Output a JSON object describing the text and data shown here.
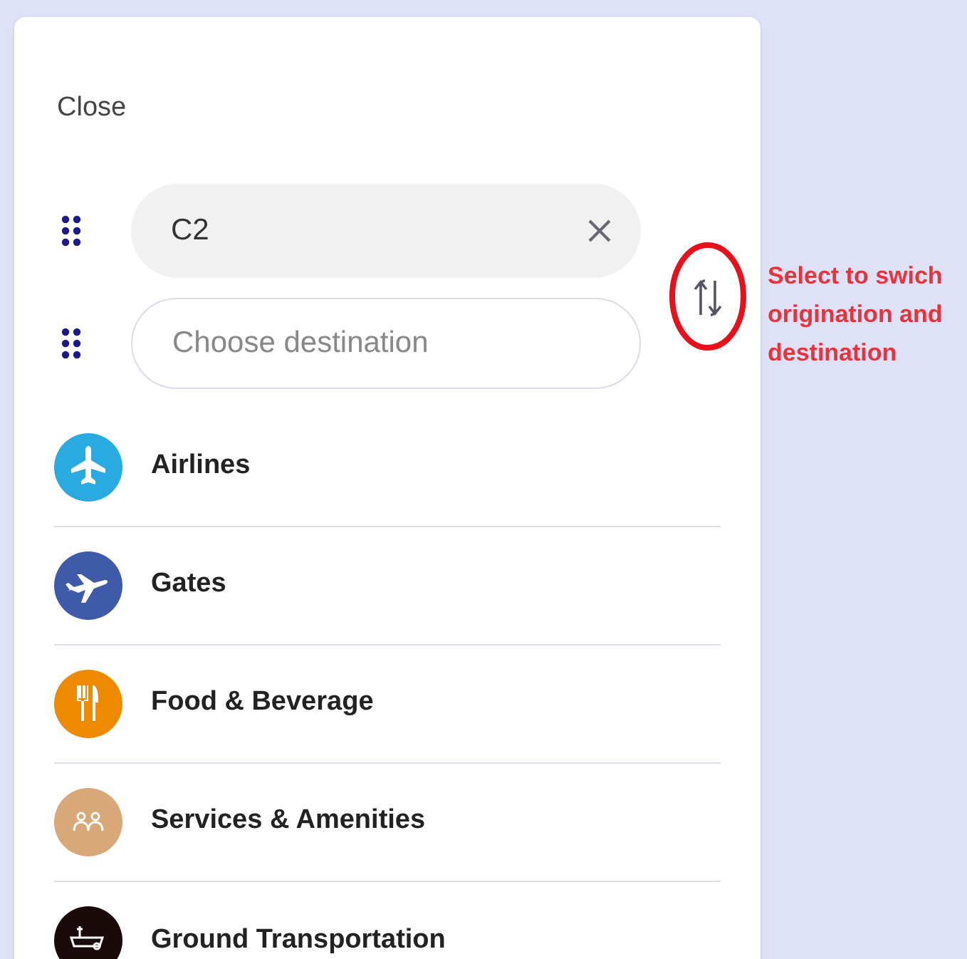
{
  "close_label": "Close",
  "origin": {
    "value": "C2"
  },
  "destination": {
    "placeholder": "Choose destination"
  },
  "annotation": "Select to swich origination and destination",
  "categories": [
    {
      "kind": "airlines",
      "label": "Airlines",
      "color": "#29abe2"
    },
    {
      "kind": "gates",
      "label": "Gates",
      "color": "#3f5aa9"
    },
    {
      "kind": "food",
      "label": "Food & Beverage",
      "color": "#ee8a00"
    },
    {
      "kind": "services",
      "label": "Services & Amenities",
      "color": "#d9a878"
    },
    {
      "kind": "ground",
      "label": "Ground Transportation",
      "color": "#1a0a0a"
    }
  ]
}
